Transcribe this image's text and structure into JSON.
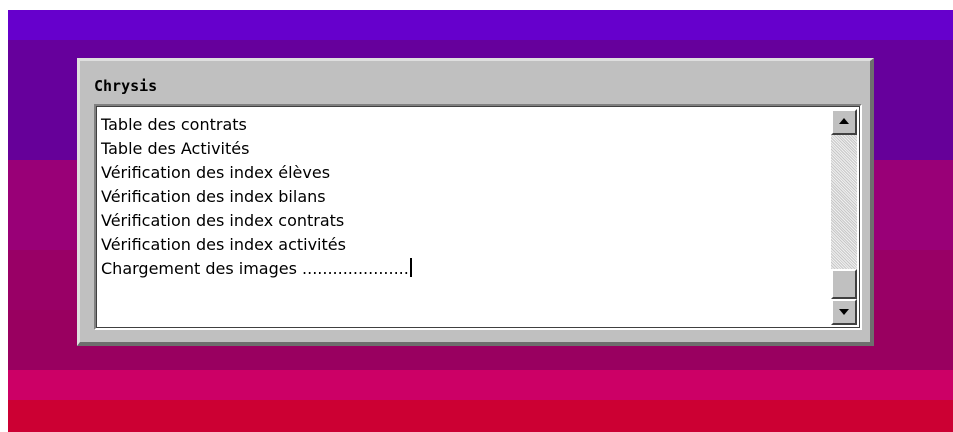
{
  "window": {
    "title": "Chrysis"
  },
  "log": {
    "lines": [
      "Table des contrats",
      "Table des Activités",
      "Vérification des index élèves",
      "Vérification des index bilans",
      "Vérification des index contrats",
      "Vérification des index activités",
      "Chargement des images ....................."
    ]
  },
  "scrollbar": {
    "up_icon": "arrow-up-icon",
    "down_icon": "arrow-down-icon",
    "position": 1.0
  },
  "colors": {
    "band_top": "#6600cc",
    "band_bottom": "#cc0033",
    "window_face": "#c0c0c0"
  }
}
